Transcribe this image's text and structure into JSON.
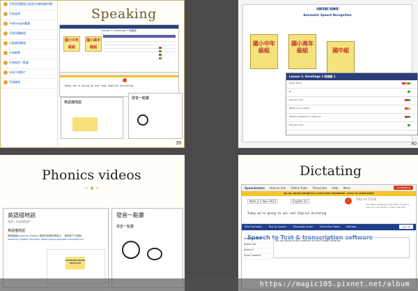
{
  "slides": [
    {
      "number": "39",
      "title": "Speaking",
      "sidebar_items": [
        "不易混淆國語口語英文(越有越好解)",
        "不易混淆",
        "不易Google翻譯",
        "不易音讀練習",
        "口語感覺練習",
        "不易教學",
        "不易發音一點靈",
        "分享下的影片",
        "不易練習"
      ],
      "lesson_title": "Lesson 1: Greetings 1 問候語 1",
      "books": [
        "國小中年級組",
        "國小高年級組"
      ],
      "english_input": "Today we're going to use real English dictating",
      "panel1_title": "英語描地説",
      "panel2_title": "發音一點靈"
    },
    {
      "number": "40",
      "doc_title": "自動英語口說練習",
      "doc_subtitle": "Automatic Speech Recognition",
      "books": [
        "國小中年級組",
        "國小高年級組",
        "國中組"
      ],
      "lesson_title": "Lesson 1: Greetings 1 問候語 1",
      "rows": [
        "Hello! Good",
        "Hi",
        "How are you?",
        "What is your name?",
        "What's a pleasure to meet you",
        "How are you?"
      ]
    },
    {
      "title": "Phonics videos",
      "flourish": "~ ❦ ~",
      "panelA_title": "英語描地説",
      "panelA_sub": "英語描地説",
      "panelA_crumb": "首頁 / 英語描地説",
      "panelA_text": "發音練習American English 發音的音素的學習以,　請參見下方連結",
      "panelA_link": "American English Youtube: https://www.youtube.com/channel/",
      "card": "PRONUNCIATION PRACTICE",
      "panelB_title": "發音一點靈",
      "panelB_sub": "發音一點靈"
    },
    {
      "title": "Dictating",
      "nav": [
        "Speechnotes",
        "How to Use",
        "Online Tools",
        "Transcribe",
        "Help",
        "More"
      ],
      "premium": "GO PREMIUM",
      "banner": "NO AD, ROUGH PROJECTS & VOICE-TYPE ANYWHERE - CLICK TO LEARN MORE",
      "editor_label": "Note_S 1 Nov 2021",
      "language": "English (U)",
      "say": "Say or Click",
      "tip": "Tip: While dictating, press Enter to start a new line, Ctrl+Enter to add a full stop.",
      "editor_line": "Today we're going to use real English dictating",
      "bar2": [
        "Start Dictation",
        "Text to Speech",
        "Transcribe Audio",
        "Transcribe Video",
        "Settings"
      ],
      "signup": "Sign Up",
      "heading": "Speech to Text & transcription software",
      "side_items": [
        "Start Dictation",
        "Zoom Out",
        "Zoom In",
        "Clear Content"
      ],
      "area_text": "We are going to do a practice of real English dictation"
    }
  ],
  "watermark": "https://magic105.pixnet.net/album"
}
